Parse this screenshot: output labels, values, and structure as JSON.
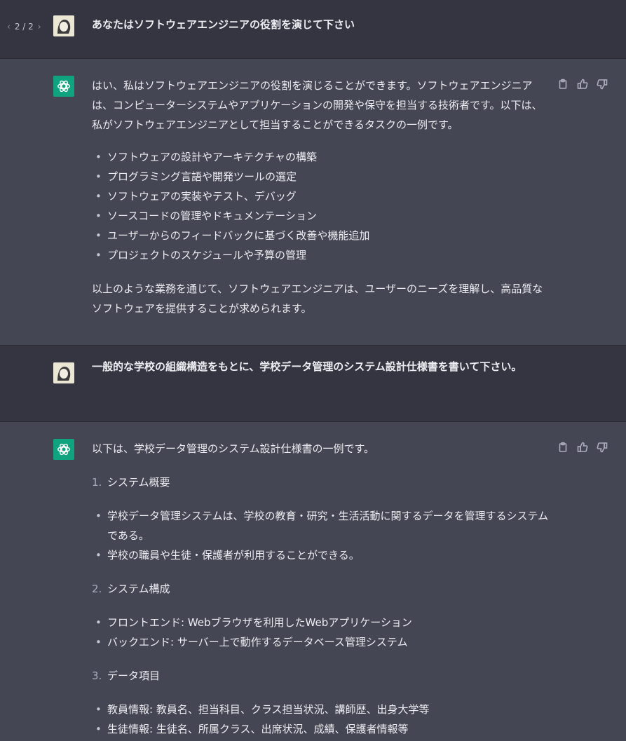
{
  "conversation": {
    "msg1": {
      "pager": "2 / 2",
      "text": "あなたはソフトウェアエンジニアの役割を演じて下さい"
    },
    "msg2": {
      "intro": "はい、私はソフトウェアエンジニアの役割を演じることができます。ソフトウェアエンジニアは、コンピューターシステムやアプリケーションの開発や保守を担当する技術者です。以下は、私がソフトウェアエンジニアとして担当することができるタスクの一例です。",
      "items": [
        "ソフトウェアの設計やアーキテクチャの構築",
        "プログラミング言語や開発ツールの選定",
        "ソフトウェアの実装やテスト、デバッグ",
        "ソースコードの管理やドキュメンテーション",
        "ユーザーからのフィードバックに基づく改善や機能追加",
        "プロジェクトのスケジュールや予算の管理"
      ],
      "outro": "以上のような業務を通じて、ソフトウェアエンジニアは、ユーザーのニーズを理解し、高品質なソフトウェアを提供することが求められます。"
    },
    "msg3": {
      "text": "一般的な学校の組織構造をもとに、学校データ管理のシステム設計仕様書を書いて下さい。"
    },
    "msg4": {
      "intro": "以下は、学校データ管理のシステム設計仕様書の一例です。",
      "sections": [
        {
          "num": "1.",
          "title": "システム概要",
          "items": [
            "学校データ管理システムは、学校の教育・研究・生活活動に関するデータを管理するシステムである。",
            "学校の職員や生徒・保護者が利用することができる。"
          ]
        },
        {
          "num": "2.",
          "title": "システム構成",
          "items": [
            "フロントエンド: Webブラウザを利用したWebアプリケーション",
            "バックエンド: サーバー上で動作するデータベース管理システム"
          ]
        },
        {
          "num": "3.",
          "title": "データ項目",
          "items": [
            "教員情報: 教員名、担当科目、クラス担当状況、講師歴、出身大学等",
            "生徒情報: 生徒名、所属クラス、出席状況、成績、保護者情報等"
          ]
        }
      ]
    }
  },
  "icons": {
    "copy": "clipboard-icon",
    "like": "thumbs-up-icon",
    "dislike": "thumbs-down-icon",
    "bot": "openai-logo-icon",
    "user": "user-avatar"
  },
  "colors": {
    "user_bg": "#343541",
    "assistant_bg": "#444654",
    "bot_avatar": "#10a37f"
  }
}
